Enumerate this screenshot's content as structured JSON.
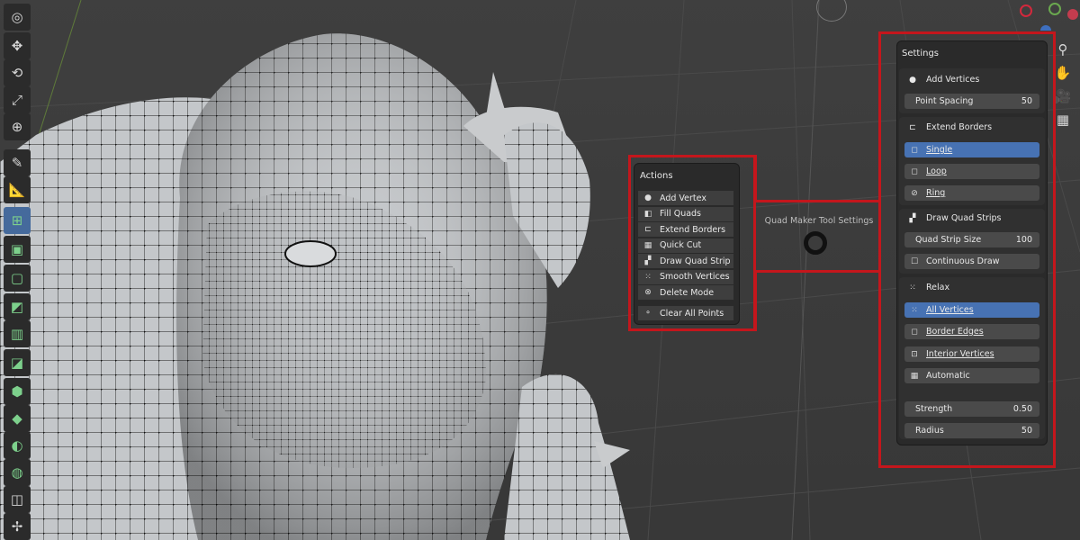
{
  "viewport": {
    "overlay_label": "Quad Maker Tool Settings"
  },
  "toolbar": {
    "tools": [
      {
        "icon": "cursor-icon",
        "glyph": "◎"
      },
      {
        "icon": "move-icon",
        "glyph": "✥"
      },
      {
        "icon": "rotate-icon",
        "glyph": "⟲"
      },
      {
        "icon": "scale-icon",
        "glyph": "⤢"
      },
      {
        "icon": "transform-icon",
        "glyph": "⊕"
      },
      {
        "icon": "annotate-icon",
        "glyph": "✎"
      },
      {
        "icon": "measure-icon",
        "glyph": "📐"
      },
      {
        "icon": "add-cube-icon",
        "glyph": "⊞"
      },
      {
        "icon": "extrude-icon",
        "glyph": "▣"
      },
      {
        "icon": "inset-icon",
        "glyph": "▢"
      },
      {
        "icon": "bevel-icon",
        "glyph": "◩"
      },
      {
        "icon": "loop-cut-icon",
        "glyph": "▥"
      },
      {
        "icon": "knife-icon",
        "glyph": "◪"
      },
      {
        "icon": "poly-build-icon",
        "glyph": "⬢"
      },
      {
        "icon": "spin-icon",
        "glyph": "◆"
      },
      {
        "icon": "smooth-icon",
        "glyph": "◐"
      },
      {
        "icon": "shrink-icon",
        "glyph": "◍"
      },
      {
        "icon": "shear-icon",
        "glyph": "◫"
      },
      {
        "icon": "rip-icon",
        "glyph": "✢"
      }
    ]
  },
  "nav": {
    "icons": [
      {
        "icon": "zoom-icon",
        "glyph": "⚲"
      },
      {
        "icon": "pan-hand-icon",
        "glyph": "✋"
      },
      {
        "icon": "camera-icon",
        "glyph": "🎥"
      },
      {
        "icon": "grid-icon",
        "glyph": "▦"
      }
    ]
  },
  "actions": {
    "title": "Actions",
    "items": [
      {
        "icon": "dot-icon",
        "glyph": "●",
        "label": "Add Vertex"
      },
      {
        "icon": "fill-quads-icon",
        "glyph": "◧",
        "label": "Fill Quads"
      },
      {
        "icon": "extend-borders-icon",
        "glyph": "⊏",
        "label": "Extend Borders"
      },
      {
        "icon": "quick-cut-icon",
        "glyph": "▦",
        "label": "Quick Cut"
      },
      {
        "icon": "draw-quad-strip-icon",
        "glyph": "▞",
        "label": "Draw Quad Strip"
      },
      {
        "icon": "smooth-vertices-icon",
        "glyph": "⁙",
        "label": "Smooth Vertices"
      },
      {
        "icon": "delete-mode-icon",
        "glyph": "⊗",
        "label": "Delete Mode"
      }
    ],
    "clear": {
      "icon": "clear-points-icon",
      "glyph": "⚬",
      "label": "Clear All Points"
    }
  },
  "settings": {
    "title": "Settings",
    "add_vertices": {
      "label": "Add Vertices",
      "glyph": "●"
    },
    "point_spacing": {
      "label": "Point Spacing",
      "value": "50"
    },
    "extend_borders": {
      "label": "Extend Borders",
      "glyph": "⊏"
    },
    "single": {
      "label": "Single",
      "glyph": "◻"
    },
    "loop": {
      "label": "Loop",
      "glyph": "◻"
    },
    "ring": {
      "label": "Ring",
      "glyph": "⊘"
    },
    "draw_quad_strips": {
      "label": "Draw Quad Strips",
      "glyph": "▞"
    },
    "quad_strip_size": {
      "label": "Quad Strip Size",
      "value": "100"
    },
    "continuous_draw": {
      "label": "Continuous Draw",
      "glyph": "☐"
    },
    "relax": {
      "label": "Relax",
      "glyph": "⁙"
    },
    "all_vertices": {
      "label": "All Vertices",
      "glyph": "⁙"
    },
    "border_edges": {
      "label": "Border Edges",
      "glyph": "◻"
    },
    "interior_vertices": {
      "label": "Interior Vertices",
      "glyph": "⊡"
    },
    "automatic": {
      "label": "Automatic",
      "glyph": "▦"
    },
    "strength": {
      "label": "Strength",
      "value": "0.50"
    },
    "radius": {
      "label": "Radius",
      "value": "50"
    }
  },
  "colors": {
    "highlight": "#c4161c",
    "selected": "#4772b3",
    "panel": "#2a2a2a",
    "mesh": "#c9cbcd"
  }
}
